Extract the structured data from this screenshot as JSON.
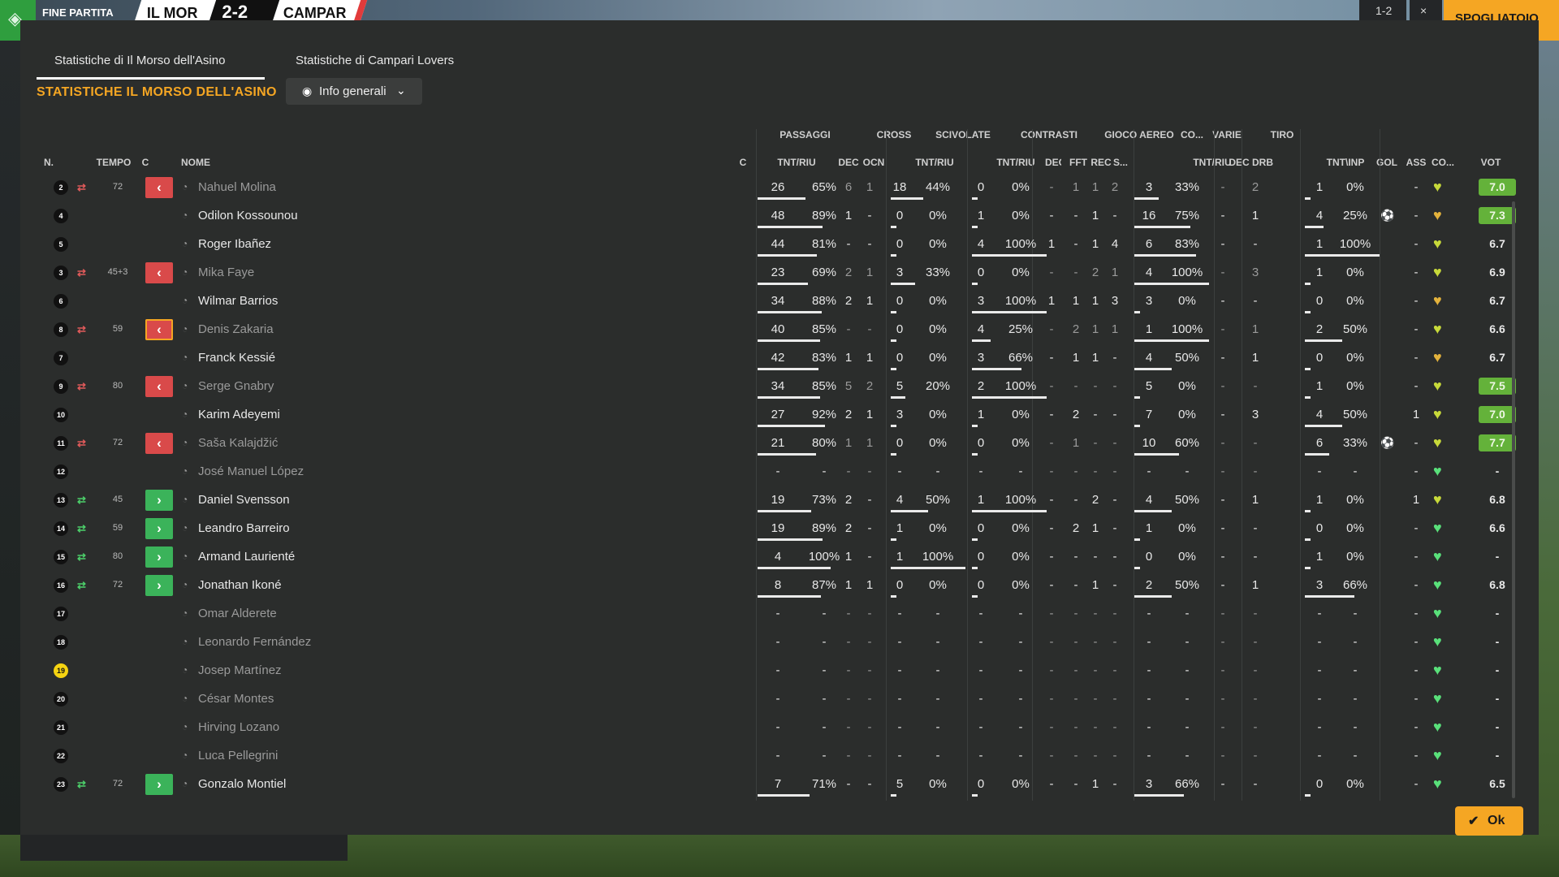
{
  "topbar": {
    "status": "FINE PARTITA",
    "home_team": "IL MOR",
    "score": "2-2",
    "away_team": "CAMPAR",
    "right_a": "1-2",
    "right_b": "×",
    "dressing_room": "SPOGLIATOIO"
  },
  "tabs": [
    "Statistiche di Il Morso dell'Asino",
    "Statistiche di Campari Lovers"
  ],
  "section_title": "STATISTICHE IL MORSO DELL'ASINO",
  "view_selector": "Info generali",
  "headers": {
    "groups": [
      "PASSAGGI",
      "CROSS",
      "SCIVOLATE",
      "CONTRASTI",
      "GIOCO AEREO",
      "CO...",
      "VARIE",
      "TIRO"
    ],
    "columns": [
      "N.",
      "TEMPO",
      "C",
      "NOME",
      "C",
      "TNT/RIU",
      "DEC",
      "OCN",
      "TNT/RIU",
      "TNT/RIU",
      "DEC",
      "FFT",
      "REC",
      "S...",
      "TNT/RIU",
      "DEC",
      "DRB",
      "TNT\\INP",
      "GOL",
      "ASS",
      "CO...",
      "VOT"
    ]
  },
  "columns_keys": [
    "pass_att",
    "pass_pct",
    "pass_dec",
    "pass_ocn",
    "cross_att",
    "cross_pct",
    "slide_att",
    "slide_pct",
    "con_dec",
    "con_fft",
    "con_rec",
    "con_s",
    "air_att",
    "air_pct",
    "co_dec",
    "drb",
    "shot_att",
    "shot_pct",
    "gol",
    "ass"
  ],
  "players": [
    {
      "n": "2",
      "swap": "out",
      "minute": "72",
      "name": "Nahuel Molina",
      "dim": true,
      "pass_att": "26",
      "pass_pct": "65%",
      "pass_bar": 0.65,
      "pass_dec": "6",
      "pass_ocn": "1",
      "cross_att": "18",
      "cross_pct": "44%",
      "cross_bar": 0.44,
      "slide_att": "0",
      "slide_pct": "0%",
      "slide_bar": 0,
      "con_dec": "-",
      "con_fft": "1",
      "con_rec": "1",
      "con_s": "2",
      "air_att": "3",
      "air_pct": "33%",
      "air_bar": 0.33,
      "co_dec": "-",
      "drb": "2",
      "shot_att": "1",
      "shot_pct": "0%",
      "shot_bar": 0,
      "gol": "",
      "ass": "-",
      "heart": "lime",
      "rating": "7.0",
      "rating_hi": true
    },
    {
      "n": "4",
      "swap": "",
      "minute": "",
      "name": "Odilon Kossounou",
      "dim": false,
      "pass_att": "48",
      "pass_pct": "89%",
      "pass_bar": 0.89,
      "pass_dec": "1",
      "pass_ocn": "-",
      "cross_att": "0",
      "cross_pct": "0%",
      "cross_bar": 0,
      "slide_att": "1",
      "slide_pct": "0%",
      "slide_bar": 0,
      "con_dec": "-",
      "con_fft": "-",
      "con_rec": "1",
      "con_s": "-",
      "air_att": "16",
      "air_pct": "75%",
      "air_bar": 0.75,
      "co_dec": "-",
      "drb": "1",
      "shot_att": "4",
      "shot_pct": "25%",
      "shot_bar": 0.25,
      "gol": "ball",
      "ass": "-",
      "heart": "gold",
      "rating": "7.3",
      "rating_hi": true
    },
    {
      "n": "5",
      "swap": "",
      "minute": "",
      "name": "Roger Ibañez",
      "dim": false,
      "pass_att": "44",
      "pass_pct": "81%",
      "pass_bar": 0.81,
      "pass_dec": "-",
      "pass_ocn": "-",
      "cross_att": "0",
      "cross_pct": "0%",
      "cross_bar": 0,
      "slide_att": "4",
      "slide_pct": "100%",
      "slide_bar": 1,
      "con_dec": "1",
      "con_fft": "-",
      "con_rec": "1",
      "con_s": "4",
      "air_att": "6",
      "air_pct": "83%",
      "air_bar": 0.83,
      "co_dec": "-",
      "drb": "-",
      "shot_att": "1",
      "shot_pct": "100%",
      "shot_bar": 1,
      "gol": "",
      "ass": "-",
      "heart": "lime",
      "rating": "6.7",
      "rating_hi": false
    },
    {
      "n": "3",
      "swap": "out",
      "minute": "45+3",
      "name": "Mika Faye",
      "dim": true,
      "pass_att": "23",
      "pass_pct": "69%",
      "pass_bar": 0.69,
      "pass_dec": "2",
      "pass_ocn": "1",
      "cross_att": "3",
      "cross_pct": "33%",
      "cross_bar": 0.33,
      "slide_att": "0",
      "slide_pct": "0%",
      "slide_bar": 0,
      "con_dec": "-",
      "con_fft": "-",
      "con_rec": "2",
      "con_s": "1",
      "air_att": "4",
      "air_pct": "100%",
      "air_bar": 1,
      "co_dec": "-",
      "drb": "3",
      "shot_att": "1",
      "shot_pct": "0%",
      "shot_bar": 0,
      "gol": "",
      "ass": "-",
      "heart": "lime",
      "rating": "6.9",
      "rating_hi": false
    },
    {
      "n": "6",
      "swap": "",
      "minute": "",
      "name": "Wilmar Barrios",
      "dim": false,
      "pass_att": "34",
      "pass_pct": "88%",
      "pass_bar": 0.88,
      "pass_dec": "2",
      "pass_ocn": "1",
      "cross_att": "0",
      "cross_pct": "0%",
      "cross_bar": 0,
      "slide_att": "3",
      "slide_pct": "100%",
      "slide_bar": 1,
      "con_dec": "1",
      "con_fft": "1",
      "con_rec": "1",
      "con_s": "3",
      "air_att": "3",
      "air_pct": "0%",
      "air_bar": 0,
      "co_dec": "-",
      "drb": "-",
      "shot_att": "0",
      "shot_pct": "0%",
      "shot_bar": 0,
      "gol": "",
      "ass": "-",
      "heart": "gold",
      "rating": "6.7",
      "rating_hi": false
    },
    {
      "n": "8",
      "swap": "out",
      "minute": "59",
      "name": "Denis Zakaria",
      "dim": true,
      "warn": true,
      "pass_att": "40",
      "pass_pct": "85%",
      "pass_bar": 0.85,
      "pass_dec": "-",
      "pass_ocn": "-",
      "cross_att": "0",
      "cross_pct": "0%",
      "cross_bar": 0,
      "slide_att": "4",
      "slide_pct": "25%",
      "slide_bar": 0.25,
      "con_dec": "-",
      "con_fft": "2",
      "con_rec": "1",
      "con_s": "1",
      "air_att": "1",
      "air_pct": "100%",
      "air_bar": 1,
      "co_dec": "-",
      "drb": "1",
      "shot_att": "2",
      "shot_pct": "50%",
      "shot_bar": 0.5,
      "gol": "",
      "ass": "-",
      "heart": "lime",
      "rating": "6.6",
      "rating_hi": false
    },
    {
      "n": "7",
      "swap": "",
      "minute": "",
      "name": "Franck Kessié",
      "dim": false,
      "pass_att": "42",
      "pass_pct": "83%",
      "pass_bar": 0.83,
      "pass_dec": "1",
      "pass_ocn": "1",
      "cross_att": "0",
      "cross_pct": "0%",
      "cross_bar": 0,
      "slide_att": "3",
      "slide_pct": "66%",
      "slide_bar": 0.66,
      "con_dec": "-",
      "con_fft": "1",
      "con_rec": "1",
      "con_s": "-",
      "air_att": "4",
      "air_pct": "50%",
      "air_bar": 0.5,
      "co_dec": "-",
      "drb": "1",
      "shot_att": "0",
      "shot_pct": "0%",
      "shot_bar": 0,
      "gol": "",
      "ass": "-",
      "heart": "gold",
      "rating": "6.7",
      "rating_hi": false
    },
    {
      "n": "9",
      "swap": "out",
      "minute": "80",
      "name": "Serge Gnabry",
      "dim": true,
      "pass_att": "34",
      "pass_pct": "85%",
      "pass_bar": 0.85,
      "pass_dec": "5",
      "pass_ocn": "2",
      "cross_att": "5",
      "cross_pct": "20%",
      "cross_bar": 0.2,
      "slide_att": "2",
      "slide_pct": "100%",
      "slide_bar": 1,
      "con_dec": "-",
      "con_fft": "-",
      "con_rec": "-",
      "con_s": "-",
      "air_att": "5",
      "air_pct": "0%",
      "air_bar": 0,
      "co_dec": "-",
      "drb": "-",
      "shot_att": "1",
      "shot_pct": "0%",
      "shot_bar": 0,
      "gol": "",
      "ass": "-",
      "heart": "lime",
      "rating": "7.5",
      "rating_hi": true
    },
    {
      "n": "10",
      "swap": "",
      "minute": "",
      "name": "Karim Adeyemi",
      "dim": false,
      "pass_att": "27",
      "pass_pct": "92%",
      "pass_bar": 0.92,
      "pass_dec": "2",
      "pass_ocn": "1",
      "cross_att": "3",
      "cross_pct": "0%",
      "cross_bar": 0,
      "slide_att": "1",
      "slide_pct": "0%",
      "slide_bar": 0,
      "con_dec": "-",
      "con_fft": "2",
      "con_rec": "-",
      "con_s": "-",
      "air_att": "7",
      "air_pct": "0%",
      "air_bar": 0,
      "co_dec": "-",
      "drb": "3",
      "shot_att": "4",
      "shot_pct": "50%",
      "shot_bar": 0.5,
      "gol": "",
      "ass": "1",
      "heart": "lime",
      "rating": "7.0",
      "rating_hi": true
    },
    {
      "n": "11",
      "swap": "out",
      "minute": "72",
      "name": "Saša Kalajdžić",
      "dim": true,
      "pass_att": "21",
      "pass_pct": "80%",
      "pass_bar": 0.8,
      "pass_dec": "1",
      "pass_ocn": "1",
      "cross_att": "0",
      "cross_pct": "0%",
      "cross_bar": 0,
      "slide_att": "0",
      "slide_pct": "0%",
      "slide_bar": 0,
      "con_dec": "-",
      "con_fft": "1",
      "con_rec": "-",
      "con_s": "-",
      "air_att": "10",
      "air_pct": "60%",
      "air_bar": 0.6,
      "co_dec": "-",
      "drb": "-",
      "shot_att": "6",
      "shot_pct": "33%",
      "shot_bar": 0.33,
      "gol": "ball",
      "ass": "-",
      "heart": "lime",
      "rating": "7.7",
      "rating_hi": true
    },
    {
      "n": "12",
      "swap": "",
      "minute": "",
      "name": "José Manuel López",
      "dim": true,
      "pass_att": "-",
      "pass_pct": "-",
      "pass_bar": 0,
      "pass_dec": "-",
      "pass_ocn": "-",
      "cross_att": "-",
      "cross_pct": "-",
      "cross_bar": 0,
      "slide_att": "-",
      "slide_pct": "-",
      "slide_bar": 0,
      "con_dec": "-",
      "con_fft": "-",
      "con_rec": "-",
      "con_s": "-",
      "air_att": "-",
      "air_pct": "-",
      "air_bar": 0,
      "co_dec": "-",
      "drb": "-",
      "shot_att": "-",
      "shot_pct": "-",
      "shot_bar": 0,
      "gol": "",
      "ass": "-",
      "heart": "green",
      "rating": "-",
      "rating_hi": false
    },
    {
      "n": "13",
      "swap": "in",
      "minute": "45",
      "name": "Daniel Svensson",
      "dim": false,
      "pass_att": "19",
      "pass_pct": "73%",
      "pass_bar": 0.73,
      "pass_dec": "2",
      "pass_ocn": "-",
      "cross_att": "4",
      "cross_pct": "50%",
      "cross_bar": 0.5,
      "slide_att": "1",
      "slide_pct": "100%",
      "slide_bar": 1,
      "con_dec": "-",
      "con_fft": "-",
      "con_rec": "2",
      "con_s": "-",
      "air_att": "4",
      "air_pct": "50%",
      "air_bar": 0.5,
      "co_dec": "-",
      "drb": "1",
      "shot_att": "1",
      "shot_pct": "0%",
      "shot_bar": 0,
      "gol": "",
      "ass": "1",
      "heart": "lime",
      "rating": "6.8",
      "rating_hi": false
    },
    {
      "n": "14",
      "swap": "in",
      "minute": "59",
      "name": "Leandro Barreiro",
      "dim": false,
      "pass_att": "19",
      "pass_pct": "89%",
      "pass_bar": 0.89,
      "pass_dec": "2",
      "pass_ocn": "-",
      "cross_att": "1",
      "cross_pct": "0%",
      "cross_bar": 0,
      "slide_att": "0",
      "slide_pct": "0%",
      "slide_bar": 0,
      "con_dec": "-",
      "con_fft": "2",
      "con_rec": "1",
      "con_s": "-",
      "air_att": "1",
      "air_pct": "0%",
      "air_bar": 0,
      "co_dec": "-",
      "drb": "-",
      "shot_att": "0",
      "shot_pct": "0%",
      "shot_bar": 0,
      "gol": "",
      "ass": "-",
      "heart": "green",
      "rating": "6.6",
      "rating_hi": false
    },
    {
      "n": "15",
      "swap": "in",
      "minute": "80",
      "name": "Armand Laurienté",
      "dim": false,
      "pass_att": "4",
      "pass_pct": "100%",
      "pass_bar": 1,
      "pass_dec": "1",
      "pass_ocn": "-",
      "cross_att": "1",
      "cross_pct": "100%",
      "cross_bar": 1,
      "slide_att": "0",
      "slide_pct": "0%",
      "slide_bar": 0,
      "con_dec": "-",
      "con_fft": "-",
      "con_rec": "-",
      "con_s": "-",
      "air_att": "0",
      "air_pct": "0%",
      "air_bar": 0,
      "co_dec": "-",
      "drb": "-",
      "shot_att": "1",
      "shot_pct": "0%",
      "shot_bar": 0,
      "gol": "",
      "ass": "-",
      "heart": "green",
      "rating": "-",
      "rating_hi": false
    },
    {
      "n": "16",
      "swap": "in",
      "minute": "72",
      "name": "Jonathan Ikoné",
      "dim": false,
      "pass_att": "8",
      "pass_pct": "87%",
      "pass_bar": 0.87,
      "pass_dec": "1",
      "pass_ocn": "1",
      "cross_att": "0",
      "cross_pct": "0%",
      "cross_bar": 0,
      "slide_att": "0",
      "slide_pct": "0%",
      "slide_bar": 0,
      "con_dec": "-",
      "con_fft": "-",
      "con_rec": "1",
      "con_s": "-",
      "air_att": "2",
      "air_pct": "50%",
      "air_bar": 0.5,
      "co_dec": "-",
      "drb": "1",
      "shot_att": "3",
      "shot_pct": "66%",
      "shot_bar": 0.66,
      "gol": "",
      "ass": "-",
      "heart": "green",
      "rating": "6.8",
      "rating_hi": false
    },
    {
      "n": "17",
      "swap": "",
      "minute": "",
      "name": "Omar Alderete",
      "dim": true,
      "pass_att": "-",
      "pass_pct": "-",
      "pass_bar": 0,
      "pass_dec": "-",
      "pass_ocn": "-",
      "cross_att": "-",
      "cross_pct": "-",
      "cross_bar": 0,
      "slide_att": "-",
      "slide_pct": "-",
      "slide_bar": 0,
      "con_dec": "-",
      "con_fft": "-",
      "con_rec": "-",
      "con_s": "-",
      "air_att": "-",
      "air_pct": "-",
      "air_bar": 0,
      "co_dec": "-",
      "drb": "-",
      "shot_att": "-",
      "shot_pct": "-",
      "shot_bar": 0,
      "gol": "",
      "ass": "-",
      "heart": "green",
      "rating": "-",
      "rating_hi": false
    },
    {
      "n": "18",
      "swap": "",
      "minute": "",
      "name": "Leonardo Fernández",
      "dim": true,
      "pass_att": "-",
      "pass_pct": "-",
      "pass_bar": 0,
      "pass_dec": "-",
      "pass_ocn": "-",
      "cross_att": "-",
      "cross_pct": "-",
      "cross_bar": 0,
      "slide_att": "-",
      "slide_pct": "-",
      "slide_bar": 0,
      "con_dec": "-",
      "con_fft": "-",
      "con_rec": "-",
      "con_s": "-",
      "air_att": "-",
      "air_pct": "-",
      "air_bar": 0,
      "co_dec": "-",
      "drb": "-",
      "shot_att": "-",
      "shot_pct": "-",
      "shot_bar": 0,
      "gol": "",
      "ass": "-",
      "heart": "green",
      "rating": "-",
      "rating_hi": false
    },
    {
      "n": "19",
      "swap": "",
      "minute": "",
      "name": "Josep Martínez",
      "dim": true,
      "gk": true,
      "pass_att": "-",
      "pass_pct": "-",
      "pass_bar": 0,
      "pass_dec": "-",
      "pass_ocn": "-",
      "cross_att": "-",
      "cross_pct": "-",
      "cross_bar": 0,
      "slide_att": "-",
      "slide_pct": "-",
      "slide_bar": 0,
      "con_dec": "-",
      "con_fft": "-",
      "con_rec": "-",
      "con_s": "-",
      "air_att": "-",
      "air_pct": "-",
      "air_bar": 0,
      "co_dec": "-",
      "drb": "-",
      "shot_att": "-",
      "shot_pct": "-",
      "shot_bar": 0,
      "gol": "",
      "ass": "-",
      "heart": "green",
      "rating": "-",
      "rating_hi": false
    },
    {
      "n": "20",
      "swap": "",
      "minute": "",
      "name": "César Montes",
      "dim": true,
      "pass_att": "-",
      "pass_pct": "-",
      "pass_bar": 0,
      "pass_dec": "-",
      "pass_ocn": "-",
      "cross_att": "-",
      "cross_pct": "-",
      "cross_bar": 0,
      "slide_att": "-",
      "slide_pct": "-",
      "slide_bar": 0,
      "con_dec": "-",
      "con_fft": "-",
      "con_rec": "-",
      "con_s": "-",
      "air_att": "-",
      "air_pct": "-",
      "air_bar": 0,
      "co_dec": "-",
      "drb": "-",
      "shot_att": "-",
      "shot_pct": "-",
      "shot_bar": 0,
      "gol": "",
      "ass": "-",
      "heart": "green",
      "rating": "-",
      "rating_hi": false
    },
    {
      "n": "21",
      "swap": "",
      "minute": "",
      "name": "Hirving Lozano",
      "dim": true,
      "pass_att": "-",
      "pass_pct": "-",
      "pass_bar": 0,
      "pass_dec": "-",
      "pass_ocn": "-",
      "cross_att": "-",
      "cross_pct": "-",
      "cross_bar": 0,
      "slide_att": "-",
      "slide_pct": "-",
      "slide_bar": 0,
      "con_dec": "-",
      "con_fft": "-",
      "con_rec": "-",
      "con_s": "-",
      "air_att": "-",
      "air_pct": "-",
      "air_bar": 0,
      "co_dec": "-",
      "drb": "-",
      "shot_att": "-",
      "shot_pct": "-",
      "shot_bar": 0,
      "gol": "",
      "ass": "-",
      "heart": "green",
      "rating": "-",
      "rating_hi": false
    },
    {
      "n": "22",
      "swap": "",
      "minute": "",
      "name": "Luca Pellegrini",
      "dim": true,
      "pass_att": "-",
      "pass_pct": "-",
      "pass_bar": 0,
      "pass_dec": "-",
      "pass_ocn": "-",
      "cross_att": "-",
      "cross_pct": "-",
      "cross_bar": 0,
      "slide_att": "-",
      "slide_pct": "-",
      "slide_bar": 0,
      "con_dec": "-",
      "con_fft": "-",
      "con_rec": "-",
      "con_s": "-",
      "air_att": "-",
      "air_pct": "-",
      "air_bar": 0,
      "co_dec": "-",
      "drb": "-",
      "shot_att": "-",
      "shot_pct": "-",
      "shot_bar": 0,
      "gol": "",
      "ass": "-",
      "heart": "green",
      "rating": "-",
      "rating_hi": false
    },
    {
      "n": "23",
      "swap": "in",
      "minute": "72",
      "name": "Gonzalo Montiel",
      "dim": false,
      "pass_att": "7",
      "pass_pct": "71%",
      "pass_bar": 0.71,
      "pass_dec": "-",
      "pass_ocn": "-",
      "cross_att": "5",
      "cross_pct": "0%",
      "cross_bar": 0,
      "slide_att": "0",
      "slide_pct": "0%",
      "slide_bar": 0,
      "con_dec": "-",
      "con_fft": "-",
      "con_rec": "1",
      "con_s": "-",
      "air_att": "3",
      "air_pct": "66%",
      "air_bar": 0.66,
      "co_dec": "-",
      "drb": "-",
      "shot_att": "0",
      "shot_pct": "0%",
      "shot_bar": 0,
      "gol": "",
      "ass": "-",
      "heart": "green",
      "rating": "6.5",
      "rating_hi": false
    }
  ],
  "ok_button": "Ok",
  "icons": {
    "eye": "eye-icon",
    "chevron": "chevron-down-icon",
    "check": "check-icon",
    "swap_out": "substitution-out-icon",
    "swap_in": "substitution-in-icon",
    "person": "player-icon",
    "heart": "condition-heart-icon",
    "ball": "goal-ball-icon"
  },
  "colors": {
    "accent": "#f5a623",
    "sub_out": "#d94a4a",
    "sub_in": "#3bb35a",
    "rating_high": "#64b23a",
    "condition_good": "#59e07a"
  }
}
